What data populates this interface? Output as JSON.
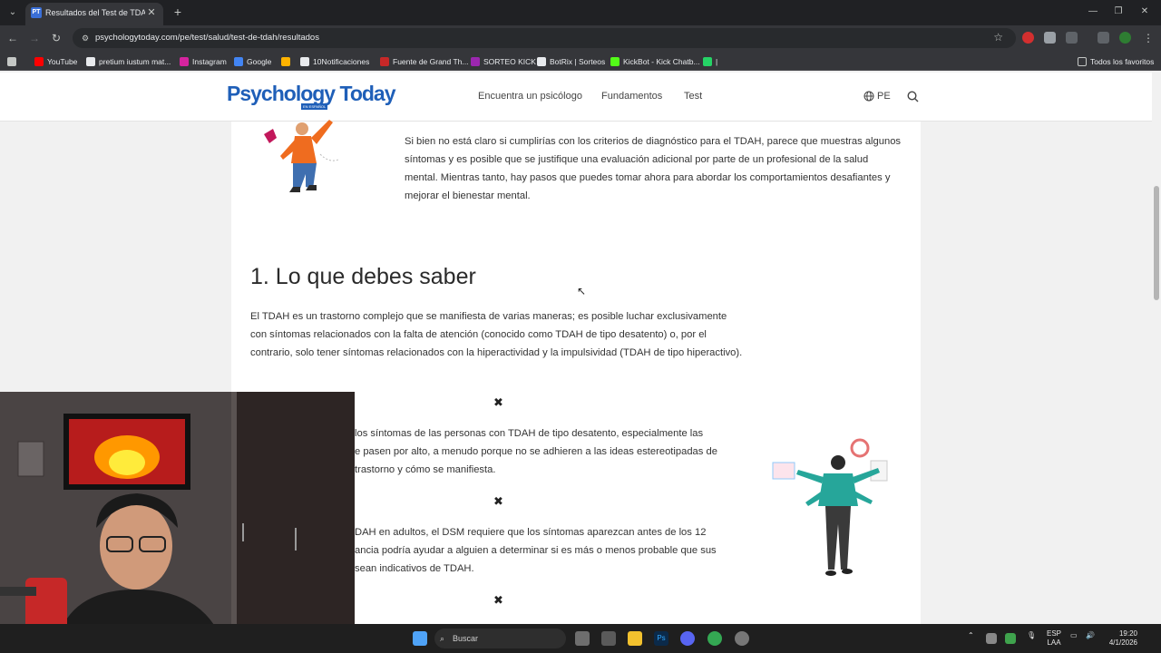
{
  "browser": {
    "tab_title": "Resultados del Test de TDAH | P",
    "tab_favicon": "PT",
    "url": "psychologytoday.com/pe/test/salud/test-de-tdah/resultados",
    "bookmarks": [
      {
        "label": "YouTube",
        "color": "#ff0000"
      },
      {
        "label": "pretium iustum mat...",
        "color": "#e8eaed"
      },
      {
        "label": "Instagram",
        "color": "#d6249f"
      },
      {
        "label": "Google",
        "color": "#4285f4"
      },
      {
        "label": "",
        "color": "#ffb300"
      },
      {
        "label": "10Notificaciones",
        "color": "#e8eaed"
      },
      {
        "label": "Fuente de Grand Th...",
        "color": "#c62828"
      },
      {
        "label": "SORTEO KICK",
        "color": "#9c27b0"
      },
      {
        "label": "BotRix | Sorteos",
        "color": "#e8eaed"
      },
      {
        "label": "KickBot - Kick Chatb...",
        "color": "#53fc18"
      },
      {
        "label": "|",
        "color": "#25d366"
      }
    ],
    "all_bookmarks": "Todos los favoritos"
  },
  "site": {
    "logo": "Psychology Today",
    "logo_sub": "EN ESPAÑOL",
    "nav": [
      "Encuentra un psicólogo",
      "Fundamentos",
      "Test"
    ],
    "lang": "PE"
  },
  "article": {
    "intro": "Si bien no está claro si cumplirías con los criterios de diagnóstico para el TDAH, parece que muestras algunos síntomas y es posible que se justifique una evaluación adicional por parte de un profesional de la salud mental. Mientras tanto, hay pasos que puedes tomar ahora para abordar los comportamientos desafiantes y mejorar el bienestar mental.",
    "heading": "1. Lo que debes saber",
    "para1": "El TDAH es un trastorno complejo que se manifiesta de varias maneras; es posible luchar exclusivamente con síntomas relacionados con la falta de atención (conocido como TDAH de tipo desatento) o, por el contrario, solo tener síntomas relacionados con la hiperactividad y la impulsividad (TDAH de tipo hiperactivo).",
    "bullet1": "los síntomas de las personas con TDAH de tipo desatento, especialmente las\ne pasen por alto, a menudo porque no se adhieren a las ideas estereotipadas de\ntrastorno y cómo se manifiesta.",
    "bullet2": "DAH en adultos, el DSM requiere que los síntomas aparezcan antes de los 12\nancia podría ayudar a alguien a determinar si es más o menos probable que sus\nsean indicativos de TDAH.",
    "separator": "✖"
  },
  "taskbar": {
    "search_placeholder": "Buscar",
    "lang_top": "ESP",
    "lang_bottom": "LAA",
    "time": "19:20",
    "date": "4/1/2026"
  }
}
